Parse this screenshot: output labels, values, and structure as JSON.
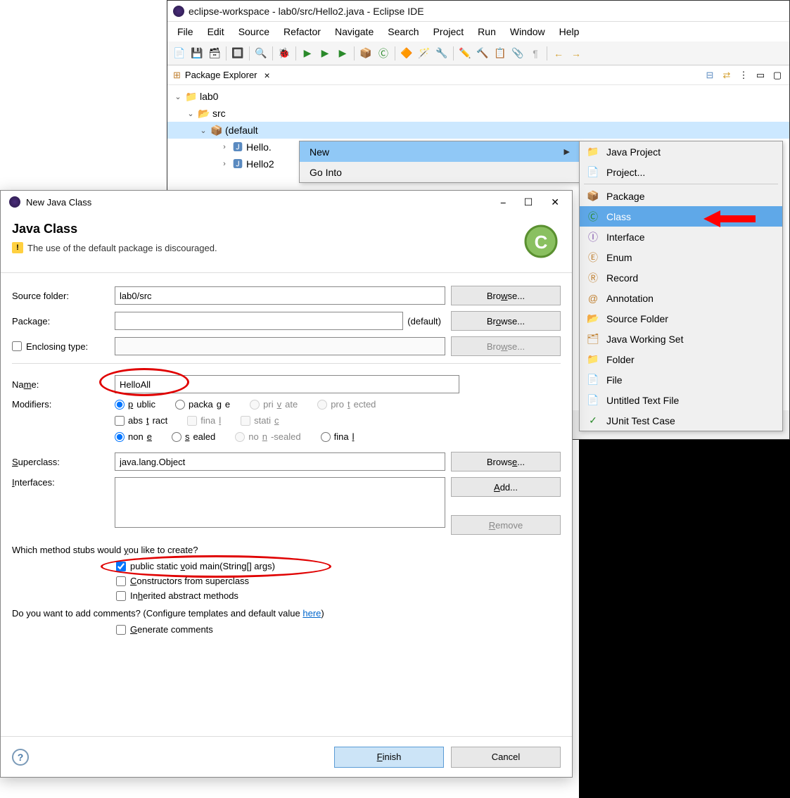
{
  "eclipse": {
    "title": "eclipse-workspace - lab0/src/Hello2.java - Eclipse IDE",
    "menu": [
      "File",
      "Edit",
      "Source",
      "Refactor",
      "Navigate",
      "Search",
      "Project",
      "Run",
      "Window",
      "Help"
    ],
    "pkgExplorer": {
      "title": "Package Explorer",
      "tree": {
        "project": "lab0",
        "src": "src",
        "pkg": "(default ",
        "file1": "Hello.",
        "file2": "Hello2"
      }
    }
  },
  "context": {
    "new": "New",
    "goInto": "Go Into"
  },
  "submenu": {
    "javaProject": "Java Project",
    "project": "Project...",
    "package": "Package",
    "class": "Class",
    "interface": "Interface",
    "enum": "Enum",
    "record": "Record",
    "annotation": "Annotation",
    "sourceFolder": "Source Folder",
    "workingSet": "Java Working Set",
    "folder": "Folder",
    "file": "File",
    "untitled": "Untitled Text File",
    "junit": "JUnit Test Case"
  },
  "dialog": {
    "windowTitle": "New Java Class",
    "heading": "Java Class",
    "warning": "The use of the default package is discouraged.",
    "labels": {
      "sourceFolder": "Source folder:",
      "package": "Package:",
      "enclosing": "Enclosing type:",
      "name": "Name:",
      "modifiers": "Modifiers:",
      "superclass": "Superclass:",
      "interfaces": "Interfaces:",
      "stubsQ": "Which method stubs would you like to create?",
      "commentsQ": "Do you want to add comments? (Configure templates and default value ",
      "here": "here",
      "default": "(default)"
    },
    "values": {
      "sourceFolder": "lab0/src",
      "package": "",
      "name": "HelloAll",
      "superclass": "java.lang.Object",
      "interfaces": ""
    },
    "buttons": {
      "browse": "Browse...",
      "add": "Add...",
      "remove": "Remove",
      "finish": "Finish",
      "cancel": "Cancel"
    },
    "modifiers": {
      "public": "public",
      "package": "package",
      "private": "private",
      "protected": "protected",
      "abstract": "abstract",
      "final": "final",
      "static": "static",
      "none": "none",
      "sealed": "sealed",
      "nonsealed": "non-sealed",
      "final2": "final"
    },
    "stubs": {
      "main": "public static void main(String[] args)",
      "constructors": "Constructors from superclass",
      "inherited": "Inherited abstract methods",
      "generate": "Generate comments"
    }
  }
}
